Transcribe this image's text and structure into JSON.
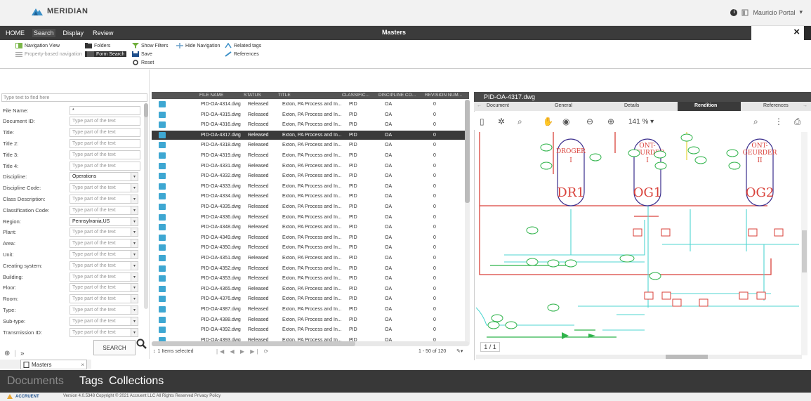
{
  "app": {
    "logo": "MERIDIAN",
    "user": "Mauricio Portal"
  },
  "menu": {
    "items": [
      "HOME",
      "Search",
      "Display",
      "Review"
    ],
    "title": "Masters",
    "close": "×"
  },
  "toolbar": {
    "navigation_view": "Navigation View",
    "property_nav": "Property-based navigation",
    "folders": "Folders",
    "form_search": "Form Search",
    "show_filters": "Show Filters",
    "save": "Save",
    "reset": "Reset",
    "hide_navigation": "Hide Navigation",
    "related_tags": "Related tags",
    "references": "References"
  },
  "search": {
    "filter_placeholder": "Type text to find here",
    "fields": [
      {
        "label": "File Name:",
        "value": "*",
        "type": "text"
      },
      {
        "label": "Document ID:",
        "value": "Type part of the text",
        "type": "text"
      },
      {
        "label": "Title:",
        "value": "Type part of the text",
        "type": "text"
      },
      {
        "label": "Title 2:",
        "value": "Type part of the text",
        "type": "text"
      },
      {
        "label": "Title 3:",
        "value": "Type part of the text",
        "type": "text"
      },
      {
        "label": "Title 4:",
        "value": "Type part of the text",
        "type": "text"
      },
      {
        "label": "Discipline:",
        "value": "Operations",
        "type": "select"
      },
      {
        "label": "Discipline Code:",
        "value": "Type part of the text",
        "type": "select"
      },
      {
        "label": "Class Description:",
        "value": "Type part of the text",
        "type": "select"
      },
      {
        "label": "Classification Code:",
        "value": "Type part of the text",
        "type": "select"
      },
      {
        "label": "Region:",
        "value": "Pennsylvania,US",
        "type": "select"
      },
      {
        "label": "Plant:",
        "value": "Type part of the text",
        "type": "select"
      },
      {
        "label": "Area:",
        "value": "Type part of the text",
        "type": "select"
      },
      {
        "label": "Unit:",
        "value": "Type part of the text",
        "type": "select"
      },
      {
        "label": "Creating system:",
        "value": "Type part of the text",
        "type": "select"
      },
      {
        "label": "Building:",
        "value": "Type part of the text",
        "type": "select"
      },
      {
        "label": "Floor:",
        "value": "Type part of the text",
        "type": "select"
      },
      {
        "label": "Room:",
        "value": "Type part of the text",
        "type": "select"
      },
      {
        "label": "Type:",
        "value": "Type part of the text",
        "type": "select"
      },
      {
        "label": "Sub-type:",
        "value": "Type part of the text",
        "type": "select"
      },
      {
        "label": "Transmission ID:",
        "value": "Type part of the text",
        "type": "select"
      }
    ],
    "button": "SEARCH",
    "nav_collapse": "»",
    "tab": "Masters"
  },
  "grid": {
    "columns": [
      "FILE NAME",
      "STATUS",
      "TITLE",
      "CLASSIFIC...",
      "DISCIPLINE CO...",
      "REVISION NUM..."
    ],
    "rows": [
      [
        "PID-OA-4314.dwg",
        "Released",
        "Exton, PA Process and In...",
        "PID",
        "OA",
        "0"
      ],
      [
        "PID-OA-4315.dwg",
        "Released",
        "Exton, PA Process and In...",
        "PID",
        "OA",
        "0"
      ],
      [
        "PID-OA-4316.dwg",
        "Released",
        "Exton, PA Process and In...",
        "PID",
        "OA",
        "0"
      ],
      [
        "PID-OA-4317.dwg",
        "Released",
        "Exton, PA Process and In...",
        "PID",
        "OA",
        "0"
      ],
      [
        "PID-OA-4318.dwg",
        "Released",
        "Exton, PA Process and In...",
        "PID",
        "OA",
        "0"
      ],
      [
        "PID-OA-4319.dwg",
        "Released",
        "Exton, PA Process and In...",
        "PID",
        "OA",
        "0"
      ],
      [
        "PID-OA-4331.dwg",
        "Released",
        "Exton, PA Process and In...",
        "PID",
        "OA",
        "0"
      ],
      [
        "PID-OA-4332.dwg",
        "Released",
        "Exton, PA Process and In...",
        "PID",
        "OA",
        "0"
      ],
      [
        "PID-OA-4333.dwg",
        "Released",
        "Exton, PA Process and In...",
        "PID",
        "OA",
        "0"
      ],
      [
        "PID-OA-4334.dwg",
        "Released",
        "Exton, PA Process and In...",
        "PID",
        "OA",
        "0"
      ],
      [
        "PID-OA-4335.dwg",
        "Released",
        "Exton, PA Process and In...",
        "PID",
        "OA",
        "0"
      ],
      [
        "PID-OA-4336.dwg",
        "Released",
        "Exton, PA Process and In...",
        "PID",
        "OA",
        "0"
      ],
      [
        "PID-OA-4348.dwg",
        "Released",
        "Exton, PA Process and In...",
        "PID",
        "OA",
        "0"
      ],
      [
        "PID-OA-4349.dwg",
        "Released",
        "Exton, PA Process and In...",
        "PID",
        "OA",
        "0"
      ],
      [
        "PID-OA-4350.dwg",
        "Released",
        "Exton, PA Process and In...",
        "PID",
        "OA",
        "0"
      ],
      [
        "PID-OA-4351.dwg",
        "Released",
        "Exton, PA Process and In...",
        "PID",
        "OA",
        "0"
      ],
      [
        "PID-OA-4352.dwg",
        "Released",
        "Exton, PA Process and In...",
        "PID",
        "OA",
        "0"
      ],
      [
        "PID-OA-4353.dwg",
        "Released",
        "Exton, PA Process and In...",
        "PID",
        "OA",
        "0"
      ],
      [
        "PID-OA-4365.dwg",
        "Released",
        "Exton, PA Process and In...",
        "PID",
        "OA",
        "0"
      ],
      [
        "PID-OA-4376.dwg",
        "Released",
        "Exton, PA Process and In...",
        "PID",
        "OA",
        "0"
      ],
      [
        "PID-OA-4387.dwg",
        "Released",
        "Exton, PA Process and In...",
        "PID",
        "OA",
        "0"
      ],
      [
        "PID-OA-4388.dwg",
        "Released",
        "Exton, PA Process and In...",
        "PID",
        "OA",
        "0"
      ],
      [
        "PID-OA-4392.dwg",
        "Released",
        "Exton, PA Process and In...",
        "PID",
        "OA",
        "0"
      ],
      [
        "PID-OA-4393.dwg",
        "Released",
        "Exton, PA Process and In...",
        "PID",
        "OA",
        "0"
      ]
    ],
    "selected_index": 3,
    "items_selected": "1 Items selected",
    "pager": "1 - 50 of 120"
  },
  "viewer": {
    "title": "PID-OA-4317.dwg",
    "tabs": [
      "Document",
      "General",
      "Details",
      "Rendition",
      "References"
    ],
    "active_tab": "Rendition",
    "zoom": "141 %",
    "page": "1 / 1",
    "drawing_labels": {
      "dr1_name": "DROGER",
      "dr1_num": "I",
      "dr1_tag": "DR1",
      "og1_name": "ONT-",
      "og1_name2": "GEURDER",
      "og1_num": "I",
      "og1_tag": "OG1",
      "og2_name": "ONT-",
      "og2_name2": "GEURDER",
      "og2_num": "II",
      "og2_tag": "OG2"
    }
  },
  "bottom": {
    "documents": "Documents",
    "tags": "Tags",
    "collections": "Collections"
  },
  "footer": {
    "brand": "ACCRUENT",
    "text": "Version 4.0.5348  Copyright © 2021 Accruent LLC  All Rights Reserved  Privacy Policy"
  }
}
